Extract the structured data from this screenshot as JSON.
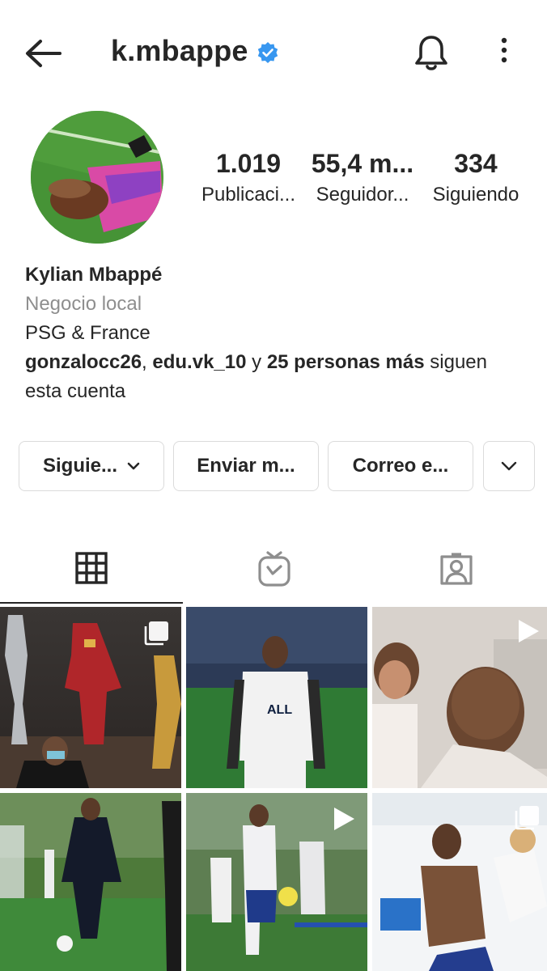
{
  "header": {
    "username": "k.mbappe",
    "verified": true,
    "icons": [
      "back-arrow-icon",
      "verified-badge-icon",
      "bell-icon",
      "more-vertical-icon"
    ]
  },
  "profile": {
    "stats": [
      {
        "value": "1.019",
        "label": "Publicaci..."
      },
      {
        "value": "55,4 m...",
        "label": "Seguidor..."
      },
      {
        "value": "334",
        "label": "Siguiendo"
      }
    ],
    "name": "Kylian Mbappé",
    "category": "Negocio local",
    "bio": "PSG & France",
    "followed_by": {
      "user1": "gonzalocc26",
      "separator": ",",
      "user2": "edu.vk_10",
      "conj": "y",
      "others": "25 personas más",
      "suffix": "siguen esta cuenta"
    }
  },
  "actions": {
    "following_label": "Siguie...",
    "message_label": "Enviar m...",
    "email_label": "Correo e..."
  },
  "tabs": [
    "grid-icon",
    "igtv-icon",
    "tagged-icon"
  ],
  "posts": [
    {
      "overlay": "carousel-icon"
    },
    {
      "overlay": ""
    },
    {
      "overlay": "play-icon"
    },
    {
      "overlay": ""
    },
    {
      "overlay": "play-icon"
    },
    {
      "overlay": "carousel-icon"
    }
  ],
  "colors": {
    "verified": "#3897f0",
    "text": "#262626",
    "secondary": "#8e8e8e",
    "border": "#dbdbdb",
    "psg_navy": "#0e1f3f"
  }
}
